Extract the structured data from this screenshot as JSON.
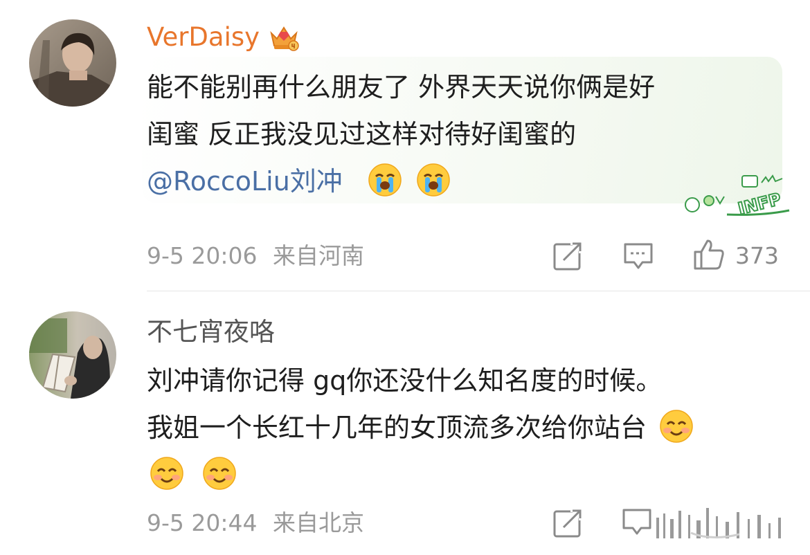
{
  "comments": [
    {
      "username": "VerDaisy",
      "badge_icon": "crown-vip-badge-icon",
      "lines": [
        "能不能别再什么朋友了 外界天天说你俩是好",
        "闺蜜 反正我没见过这样对待好闺蜜的"
      ],
      "mention": "@RoccoLiu刘冲",
      "emojis": [
        "crying-face-emoji",
        "crying-face-emoji"
      ],
      "time": "9-5 20:06",
      "location": "来自河南",
      "likes": "373",
      "decoration": "INFP"
    },
    {
      "username": "不七宵夜咯",
      "lines": [
        "刘冲请你记得 gq你还没什么知名度的时候。",
        "我姐一个长红十几年的女顶流多次给你站台"
      ],
      "emojis": [
        "smiling-face-emoji",
        "smiling-face-emoji",
        "smiling-face-emoji"
      ],
      "time": "9-5 20:44",
      "location": "来自北京"
    }
  ],
  "colors": {
    "vip_name": "#e8762c",
    "normal_name": "#555555",
    "mention": "#4a6fa5",
    "meta": "#9a9a9a",
    "bubble_tint": "#eef6ea"
  }
}
